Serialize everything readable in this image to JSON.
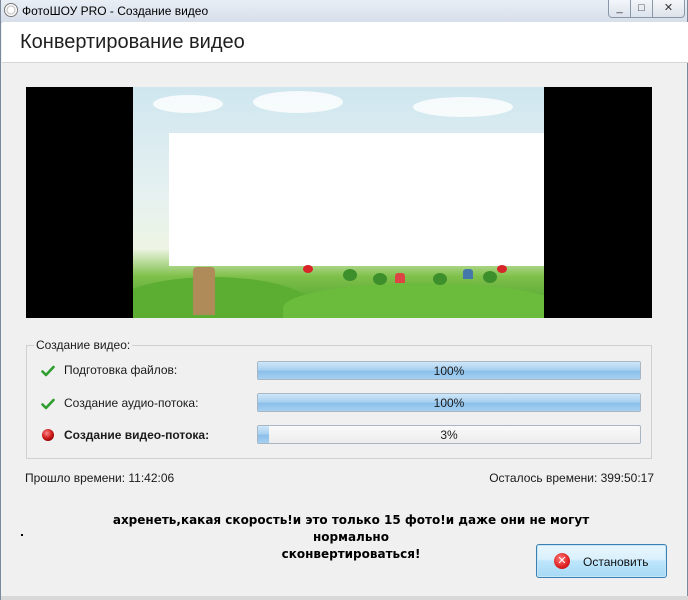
{
  "window": {
    "title": "ФотоШОУ PRO - Создание видео",
    "minimize_glyph": "_",
    "maximize_glyph": "□",
    "close_glyph": "✕"
  },
  "header": {
    "title": "Конвертирование видео"
  },
  "progress_group": {
    "label": "Создание видео:",
    "rows": [
      {
        "label": "Подготовка файлов:",
        "status": "done",
        "icon": "checkmark-icon",
        "percent_text": "100%",
        "progress": 1.0
      },
      {
        "label": "Создание аудио-потока:",
        "status": "done",
        "icon": "checkmark-icon",
        "percent_text": "100%",
        "progress": 1.0
      },
      {
        "label": "Создание видео-потока:",
        "status": "active",
        "icon": "red-dot-icon",
        "percent_text": "3%",
        "progress": 0.03
      }
    ]
  },
  "time": {
    "elapsed": "Прошло времени: 11:42:06",
    "remaining": "Осталось времени: 399:50:17"
  },
  "comment": {
    "line1": "ахренеть,какая скорость!и это только 15 фото!и даже они не могут нормально",
    "line2": "сконвертироваться!"
  },
  "stop_button": {
    "label": "Остановить",
    "icon": "stop-icon"
  },
  "colors": {
    "progress_fill": "#a9d1f1",
    "check_green": "#2e9e2e",
    "active_red": "#d22222"
  }
}
